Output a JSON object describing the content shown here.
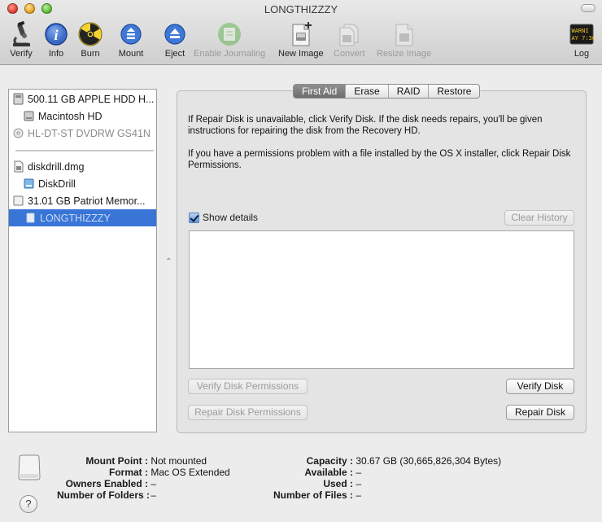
{
  "window": {
    "title": "LONGTHIZZZY"
  },
  "toolbar": {
    "verify": "Verify",
    "info": "Info",
    "burn": "Burn",
    "mount": "Mount",
    "eject": "Eject",
    "enable_journaling": "Enable Journaling",
    "new_image": "New Image",
    "convert": "Convert",
    "resize_image": "Resize Image",
    "log": "Log",
    "log_icon_text_1": "WARNI",
    "log_icon_text_2": "AY 7:36"
  },
  "sidebar": {
    "items": [
      {
        "label": "500.11 GB APPLE HDD H...",
        "icon": "hard-disk-icon"
      },
      {
        "label": "Macintosh HD",
        "icon": "volume-icon"
      },
      {
        "label": "HL-DT-ST DVDRW GS41N",
        "icon": "optical-drive-icon"
      },
      {
        "label": "diskdrill.dmg",
        "icon": "disk-image-icon"
      },
      {
        "label": "DiskDrill",
        "icon": "mounted-image-icon"
      },
      {
        "label": "31.01 GB Patriot Memor...",
        "icon": "usb-drive-icon"
      },
      {
        "label": "LONGTHIZZZY",
        "icon": "volume-icon"
      }
    ]
  },
  "tabs": [
    "First Aid",
    "Erase",
    "RAID",
    "Restore"
  ],
  "first_aid": {
    "paragraph1": "If Repair Disk is unavailable, click Verify Disk. If the disk needs repairs, you'll be given instructions for repairing the disk from the Recovery HD.",
    "paragraph2": "If you have a permissions problem with a file installed by the OS X installer, click Repair Disk Permissions.",
    "show_details": "Show details",
    "clear_history": "Clear History",
    "verify_permissions": "Verify Disk Permissions",
    "verify_disk": "Verify Disk",
    "repair_permissions": "Repair Disk Permissions",
    "repair_disk": "Repair Disk"
  },
  "info": {
    "mount_point_label": "Mount Point :",
    "mount_point": "Not mounted",
    "format_label": "Format :",
    "format": "Mac OS Extended",
    "owners_label": "Owners Enabled :",
    "owners": "–",
    "folders_label": "Number of Folders :",
    "folders": "–",
    "capacity_label": "Capacity :",
    "capacity": "30.67 GB (30,665,826,304 Bytes)",
    "available_label": "Available :",
    "available": "–",
    "used_label": "Used :",
    "used": "–",
    "files_label": "Number of Files :",
    "files": "–"
  },
  "help": "?",
  "colors": {
    "selection": "#3875d7",
    "accent_blue": "#3a6fd0"
  }
}
